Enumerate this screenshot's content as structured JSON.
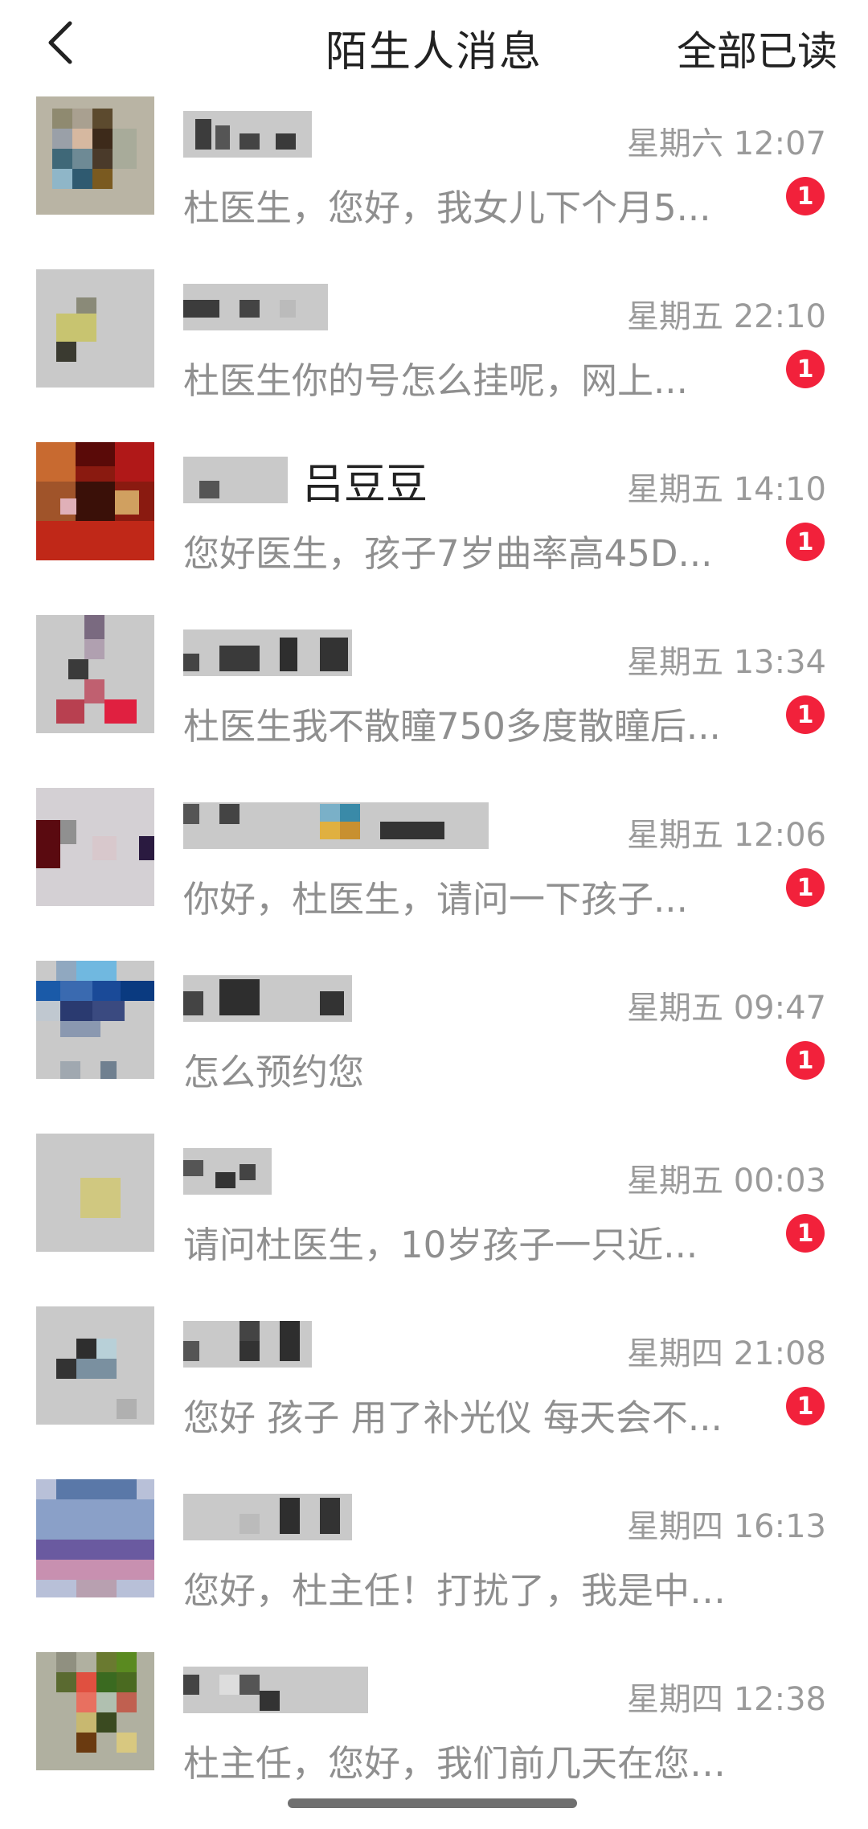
{
  "header": {
    "title": "陌生人消息",
    "action_label": "全部已读",
    "back_icon": "chevron-left-icon"
  },
  "colors": {
    "badge": "#f2213b",
    "time": "#9a9a9a",
    "preview": "#8f8f8f",
    "title": "#222222"
  },
  "conversations": [
    {
      "name": "",
      "time": "星期六 12:07",
      "preview": "杜医生，您好，我女儿下个月5...",
      "unread": "1"
    },
    {
      "name": "",
      "time": "星期五 22:10",
      "preview": "杜医生你的号怎么挂呢，网上...",
      "unread": "1"
    },
    {
      "name": "吕豆豆",
      "time": "星期五 14:10",
      "preview": "您好医生，孩子7岁曲率高45D...",
      "unread": "1"
    },
    {
      "name": "",
      "time": "星期五 13:34",
      "preview": "杜医生我不散瞳750多度散瞳后...",
      "unread": "1"
    },
    {
      "name": "",
      "time": "星期五 12:06",
      "preview": "你好，杜医生，请问一下孩子...",
      "unread": "1"
    },
    {
      "name": "",
      "time": "星期五 09:47",
      "preview": "怎么预约您",
      "unread": "1"
    },
    {
      "name": "",
      "time": "星期五 00:03",
      "preview": "请问杜医生，10岁孩子一只近...",
      "unread": "1"
    },
    {
      "name": "",
      "time": "星期四 21:08",
      "preview": "您好 孩子 用了补光仪 每天会不...",
      "unread": "1"
    },
    {
      "name": "",
      "time": "星期四 16:13",
      "preview": "您好，杜主任！打扰了，我是中秋...",
      "unread": ""
    },
    {
      "name": "",
      "time": "星期四 12:38",
      "preview": "杜主任，您好，我们前几天在您那...",
      "unread": ""
    }
  ]
}
